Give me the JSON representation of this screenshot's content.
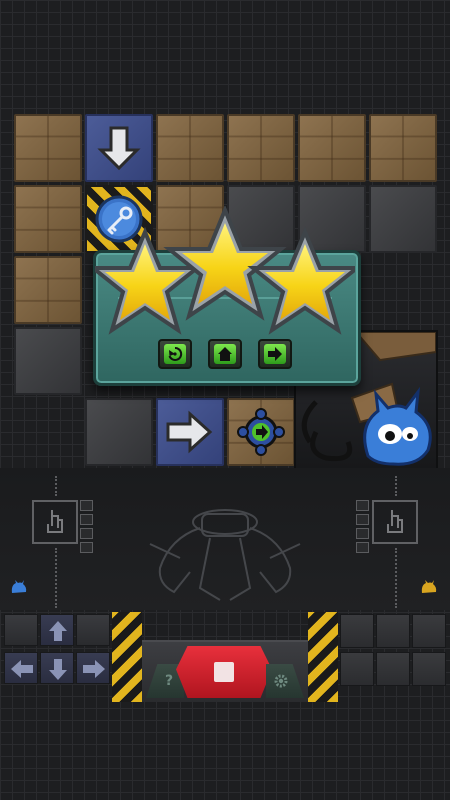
{
  "level_complete": {
    "stars_earned": 3,
    "stars_total": 3,
    "buttons": [
      "replay",
      "home",
      "next"
    ]
  },
  "board": {
    "arrows": [
      "down",
      "right"
    ]
  },
  "controls": {
    "dpad": [
      "up",
      "left",
      "down",
      "right"
    ],
    "stop_button": "stop",
    "help_label": "?",
    "settings_icon": "gear-icon"
  },
  "colors": {
    "star": "#f7d417",
    "panel": "#3f7f79",
    "stop_red": "#d91f2c",
    "hazard": "#e2b51e",
    "action_green": "#45c42a"
  }
}
